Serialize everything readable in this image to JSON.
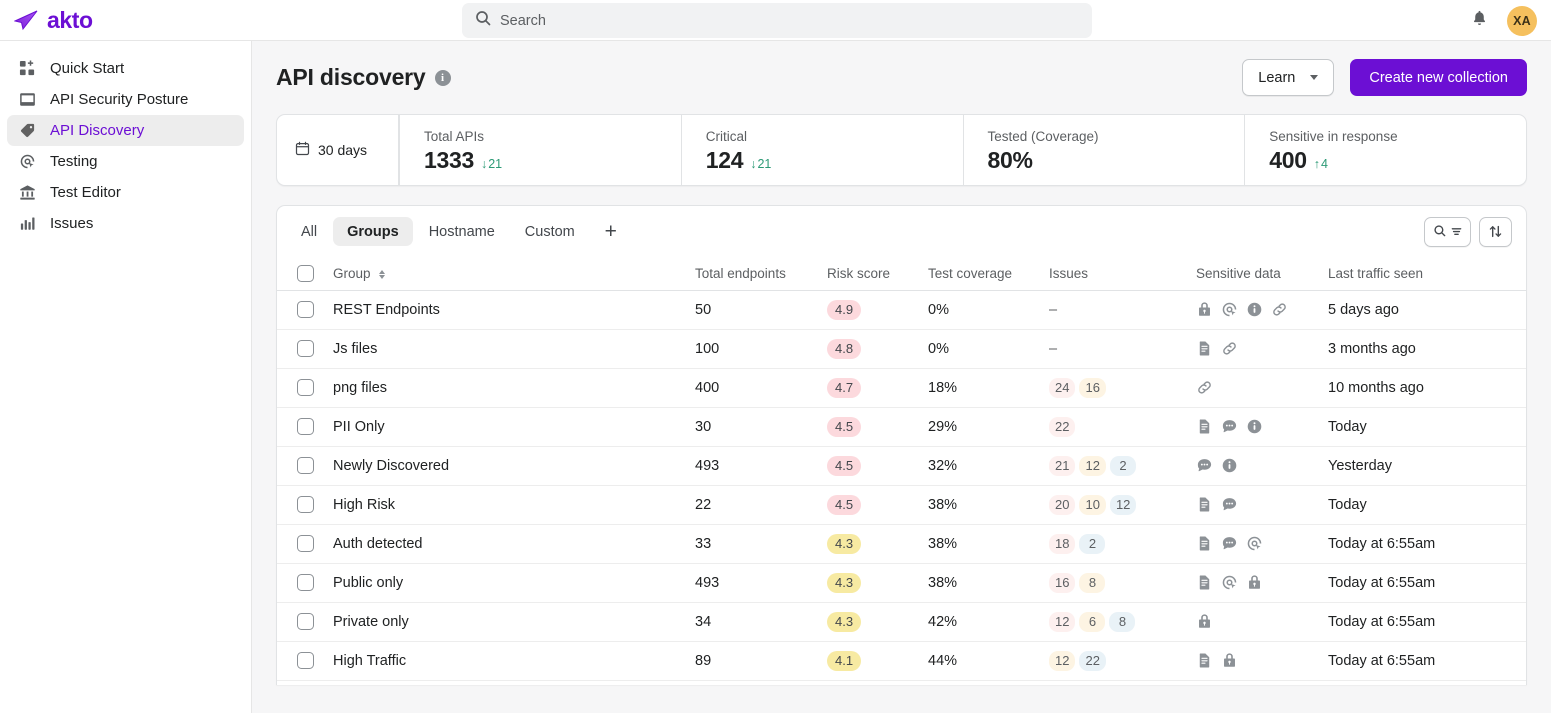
{
  "brand": {
    "name": "akto"
  },
  "search": {
    "placeholder": "Search",
    "value": ""
  },
  "topbar": {
    "notifications_icon": "bell-icon",
    "avatar_initials": "XA"
  },
  "sidebar": {
    "items": [
      {
        "label": "Quick Start",
        "icon": "grid-plus-icon",
        "active": false
      },
      {
        "label": "API Security Posture",
        "icon": "inbox-icon",
        "active": false
      },
      {
        "label": "API Discovery",
        "icon": "tag-icon",
        "active": true
      },
      {
        "label": "Testing",
        "icon": "target-click-icon",
        "active": false
      },
      {
        "label": "Test Editor",
        "icon": "bank-icon",
        "active": false
      },
      {
        "label": "Issues",
        "icon": "bar-chart-icon",
        "active": false
      }
    ]
  },
  "page": {
    "title": "API discovery",
    "info_icon": "info-icon",
    "learn_label": "Learn",
    "create_label": "Create new collection"
  },
  "stats": {
    "range_label": "30 days",
    "range_icon": "calendar-icon",
    "cells": [
      {
        "label": "Total APIs",
        "value": "1333",
        "delta": "21",
        "direction": "down"
      },
      {
        "label": "Critical",
        "value": "124",
        "delta": "21",
        "direction": "down"
      },
      {
        "label": "Tested (Coverage)",
        "value": "80%",
        "delta": "",
        "direction": ""
      },
      {
        "label": "Sensitive in response",
        "value": "400",
        "delta": "4",
        "direction": "up"
      }
    ]
  },
  "tabs": {
    "items": [
      {
        "label": "All",
        "active": false
      },
      {
        "label": "Groups",
        "active": true
      },
      {
        "label": "Hostname",
        "active": false
      },
      {
        "label": "Custom",
        "active": false
      }
    ],
    "add_label": "+",
    "tools": [
      {
        "icon": "search-filter-icon"
      },
      {
        "icon": "sort-arrows-icon"
      }
    ]
  },
  "table": {
    "columns": [
      "Group",
      "Total endpoints",
      "Risk score",
      "Test coverage",
      "Issues",
      "Sensitive data",
      "Last traffic seen"
    ],
    "rows": [
      {
        "group": "REST Endpoints",
        "endpoints": "50",
        "risk": "4.9",
        "risk_tone": "red",
        "coverage": "0%",
        "issues": [],
        "issues_dash": "–",
        "sensitive": [
          "lock-icon",
          "target-click-icon",
          "info-icon",
          "link-icon"
        ],
        "last": "5 days ago"
      },
      {
        "group": "Js files",
        "endpoints": "100",
        "risk": "4.8",
        "risk_tone": "red",
        "coverage": "0%",
        "issues": [],
        "issues_dash": "–",
        "sensitive": [
          "document-icon",
          "link-icon"
        ],
        "last": "3 months ago"
      },
      {
        "group": "png files",
        "endpoints": "400",
        "risk": "4.7",
        "risk_tone": "red",
        "coverage": "18%",
        "issues": [
          {
            "count": "24",
            "sev": "sev-high"
          },
          {
            "count": "16",
            "sev": "sev-med"
          }
        ],
        "sensitive": [
          "link-icon"
        ],
        "last": "10 months ago"
      },
      {
        "group": "PII Only",
        "endpoints": "30",
        "risk": "4.5",
        "risk_tone": "red",
        "coverage": "29%",
        "issues": [
          {
            "count": "22",
            "sev": "sev-high"
          }
        ],
        "sensitive": [
          "document-icon",
          "chat-icon",
          "info-icon"
        ],
        "last": "Today"
      },
      {
        "group": "Newly Discovered",
        "endpoints": "493",
        "risk": "4.5",
        "risk_tone": "red",
        "coverage": "32%",
        "issues": [
          {
            "count": "21",
            "sev": "sev-high"
          },
          {
            "count": "12",
            "sev": "sev-med"
          },
          {
            "count": "2",
            "sev": "sev-low"
          }
        ],
        "sensitive": [
          "chat-icon",
          "info-icon"
        ],
        "last": "Yesterday"
      },
      {
        "group": "High Risk",
        "endpoints": "22",
        "risk": "4.5",
        "risk_tone": "red",
        "coverage": "38%",
        "issues": [
          {
            "count": "20",
            "sev": "sev-high"
          },
          {
            "count": "10",
            "sev": "sev-med"
          },
          {
            "count": "12",
            "sev": "sev-low"
          }
        ],
        "sensitive": [
          "document-icon",
          "chat-icon"
        ],
        "last": "Today"
      },
      {
        "group": "Auth detected",
        "endpoints": "33",
        "risk": "4.3",
        "risk_tone": "yellow",
        "coverage": "38%",
        "issues": [
          {
            "count": "18",
            "sev": "sev-high"
          },
          {
            "count": "2",
            "sev": "sev-low"
          }
        ],
        "sensitive": [
          "document-icon",
          "chat-icon",
          "target-click-icon"
        ],
        "last": "Today at 6:55am"
      },
      {
        "group": "Public only",
        "endpoints": "493",
        "risk": "4.3",
        "risk_tone": "yellow",
        "coverage": "38%",
        "issues": [
          {
            "count": "16",
            "sev": "sev-high"
          },
          {
            "count": "8",
            "sev": "sev-med"
          }
        ],
        "sensitive": [
          "document-icon",
          "target-click-icon",
          "lock-icon"
        ],
        "last": "Today at 6:55am"
      },
      {
        "group": "Private only",
        "endpoints": "34",
        "risk": "4.3",
        "risk_tone": "yellow",
        "coverage": "42%",
        "issues": [
          {
            "count": "12",
            "sev": "sev-high"
          },
          {
            "count": "6",
            "sev": "sev-med"
          },
          {
            "count": "8",
            "sev": "sev-low"
          }
        ],
        "sensitive": [
          "lock-icon"
        ],
        "last": "Today at 6:55am"
      },
      {
        "group": "High Traffic",
        "endpoints": "89",
        "risk": "4.1",
        "risk_tone": "yellow",
        "coverage": "44%",
        "issues": [
          {
            "count": "12",
            "sev": "sev-med"
          },
          {
            "count": "22",
            "sev": "sev-low"
          }
        ],
        "sensitive": [
          "document-icon",
          "lock-icon"
        ],
        "last": "Today at 6:55am"
      }
    ]
  },
  "colors": {
    "brand_purple": "#6c0fd4",
    "risk_red": "#fcd9dd",
    "risk_yellow": "#f7eaa2",
    "delta_green": "#2c9a76",
    "avatar_bg": "#f5c05e"
  }
}
